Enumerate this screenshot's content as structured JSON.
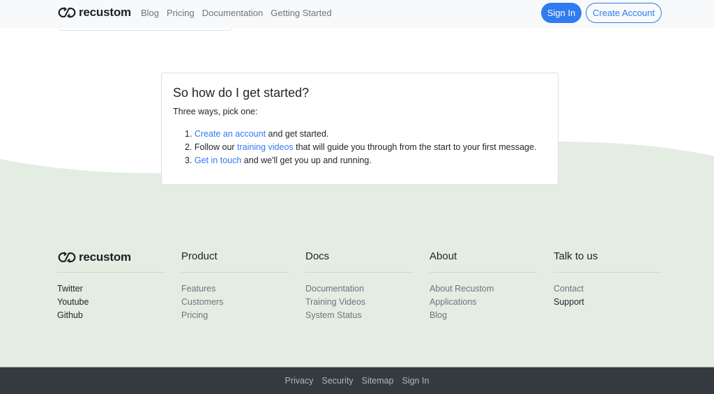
{
  "colors": {
    "primary": "#2f7bf0",
    "navbar_bg": "#f8f9fa",
    "footer_bg": "#e3ede2",
    "bottombar_bg": "#343a40",
    "muted_text": "#6c757d",
    "body_text": "#212529"
  },
  "navbar": {
    "brand": {
      "icon": "recustom-logo-icon",
      "name": "recustom"
    },
    "links": [
      {
        "label": "Blog"
      },
      {
        "label": "Pricing"
      },
      {
        "label": "Documentation"
      },
      {
        "label": "Getting Started"
      }
    ],
    "sign_in_label": "Sign In",
    "create_account_label": "Create Account"
  },
  "getting_started": {
    "title": "So how do I get started?",
    "intro": "Three ways, pick one:",
    "steps": [
      {
        "number": "1.",
        "link_text": "Create an account",
        "rest": " and get started."
      },
      {
        "number": "2.",
        "before": "Follow our ",
        "link_text": "training videos",
        "rest": " that will guide you through from the start to your first message."
      },
      {
        "number": "3.",
        "link_text": "Get in touch",
        "rest": " and we'll get you up and running."
      }
    ]
  },
  "footer": {
    "brand": {
      "icon": "recustom-logo-icon",
      "name": "recustom"
    },
    "brand_links": [
      {
        "label": "Twitter"
      },
      {
        "label": "Youtube"
      },
      {
        "label": "Github"
      }
    ],
    "columns": [
      {
        "heading": "Product",
        "links": [
          {
            "label": "Features"
          },
          {
            "label": "Customers"
          },
          {
            "label": "Pricing"
          }
        ]
      },
      {
        "heading": "Docs",
        "links": [
          {
            "label": "Documentation"
          },
          {
            "label": "Training Videos"
          },
          {
            "label": "System Status"
          }
        ]
      },
      {
        "heading": "About",
        "links": [
          {
            "label": "About Recustom"
          },
          {
            "label": "Applications"
          },
          {
            "label": "Blog"
          }
        ]
      },
      {
        "heading": "Talk to us",
        "links": [
          {
            "label": "Contact"
          },
          {
            "label": "Support"
          }
        ]
      }
    ]
  },
  "bottom_bar": {
    "links": [
      {
        "label": "Privacy"
      },
      {
        "label": "Security"
      },
      {
        "label": "Sitemap"
      },
      {
        "label": "Sign In"
      }
    ]
  }
}
